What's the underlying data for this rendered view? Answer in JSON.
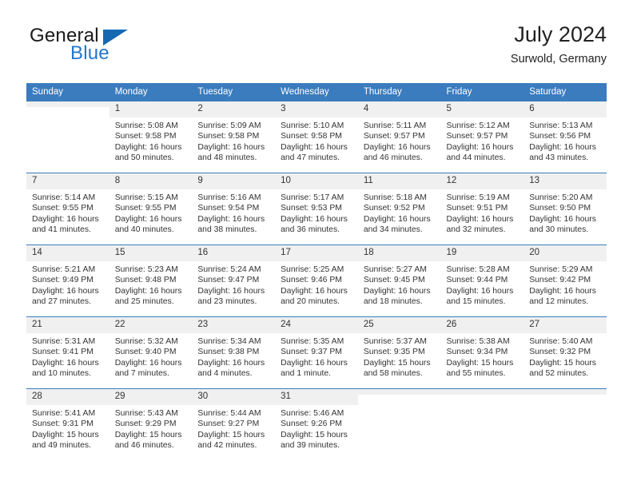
{
  "brand": {
    "name_part1": "General",
    "name_part2": "Blue",
    "triangle_color": "#1668b3",
    "blue_color": "#2277cc"
  },
  "header": {
    "title": "July 2024",
    "subtitle": "Surwold, Germany",
    "header_bg": "#3a7cbe",
    "daynum_bg": "#f0f0f0"
  },
  "weekdays": [
    "Sunday",
    "Monday",
    "Tuesday",
    "Wednesday",
    "Thursday",
    "Friday",
    "Saturday"
  ],
  "labels": {
    "sunrise": "Sunrise:",
    "sunset": "Sunset:",
    "daylight": "Daylight:"
  },
  "weeks": [
    [
      {
        "day": "",
        "sunrise": "",
        "sunset": "",
        "daylight1": "",
        "daylight2": ""
      },
      {
        "day": "1",
        "sunrise": "Sunrise: 5:08 AM",
        "sunset": "Sunset: 9:58 PM",
        "daylight1": "Daylight: 16 hours",
        "daylight2": "and 50 minutes."
      },
      {
        "day": "2",
        "sunrise": "Sunrise: 5:09 AM",
        "sunset": "Sunset: 9:58 PM",
        "daylight1": "Daylight: 16 hours",
        "daylight2": "and 48 minutes."
      },
      {
        "day": "3",
        "sunrise": "Sunrise: 5:10 AM",
        "sunset": "Sunset: 9:58 PM",
        "daylight1": "Daylight: 16 hours",
        "daylight2": "and 47 minutes."
      },
      {
        "day": "4",
        "sunrise": "Sunrise: 5:11 AM",
        "sunset": "Sunset: 9:57 PM",
        "daylight1": "Daylight: 16 hours",
        "daylight2": "and 46 minutes."
      },
      {
        "day": "5",
        "sunrise": "Sunrise: 5:12 AM",
        "sunset": "Sunset: 9:57 PM",
        "daylight1": "Daylight: 16 hours",
        "daylight2": "and 44 minutes."
      },
      {
        "day": "6",
        "sunrise": "Sunrise: 5:13 AM",
        "sunset": "Sunset: 9:56 PM",
        "daylight1": "Daylight: 16 hours",
        "daylight2": "and 43 minutes."
      }
    ],
    [
      {
        "day": "7",
        "sunrise": "Sunrise: 5:14 AM",
        "sunset": "Sunset: 9:55 PM",
        "daylight1": "Daylight: 16 hours",
        "daylight2": "and 41 minutes."
      },
      {
        "day": "8",
        "sunrise": "Sunrise: 5:15 AM",
        "sunset": "Sunset: 9:55 PM",
        "daylight1": "Daylight: 16 hours",
        "daylight2": "and 40 minutes."
      },
      {
        "day": "9",
        "sunrise": "Sunrise: 5:16 AM",
        "sunset": "Sunset: 9:54 PM",
        "daylight1": "Daylight: 16 hours",
        "daylight2": "and 38 minutes."
      },
      {
        "day": "10",
        "sunrise": "Sunrise: 5:17 AM",
        "sunset": "Sunset: 9:53 PM",
        "daylight1": "Daylight: 16 hours",
        "daylight2": "and 36 minutes."
      },
      {
        "day": "11",
        "sunrise": "Sunrise: 5:18 AM",
        "sunset": "Sunset: 9:52 PM",
        "daylight1": "Daylight: 16 hours",
        "daylight2": "and 34 minutes."
      },
      {
        "day": "12",
        "sunrise": "Sunrise: 5:19 AM",
        "sunset": "Sunset: 9:51 PM",
        "daylight1": "Daylight: 16 hours",
        "daylight2": "and 32 minutes."
      },
      {
        "day": "13",
        "sunrise": "Sunrise: 5:20 AM",
        "sunset": "Sunset: 9:50 PM",
        "daylight1": "Daylight: 16 hours",
        "daylight2": "and 30 minutes."
      }
    ],
    [
      {
        "day": "14",
        "sunrise": "Sunrise: 5:21 AM",
        "sunset": "Sunset: 9:49 PM",
        "daylight1": "Daylight: 16 hours",
        "daylight2": "and 27 minutes."
      },
      {
        "day": "15",
        "sunrise": "Sunrise: 5:23 AM",
        "sunset": "Sunset: 9:48 PM",
        "daylight1": "Daylight: 16 hours",
        "daylight2": "and 25 minutes."
      },
      {
        "day": "16",
        "sunrise": "Sunrise: 5:24 AM",
        "sunset": "Sunset: 9:47 PM",
        "daylight1": "Daylight: 16 hours",
        "daylight2": "and 23 minutes."
      },
      {
        "day": "17",
        "sunrise": "Sunrise: 5:25 AM",
        "sunset": "Sunset: 9:46 PM",
        "daylight1": "Daylight: 16 hours",
        "daylight2": "and 20 minutes."
      },
      {
        "day": "18",
        "sunrise": "Sunrise: 5:27 AM",
        "sunset": "Sunset: 9:45 PM",
        "daylight1": "Daylight: 16 hours",
        "daylight2": "and 18 minutes."
      },
      {
        "day": "19",
        "sunrise": "Sunrise: 5:28 AM",
        "sunset": "Sunset: 9:44 PM",
        "daylight1": "Daylight: 16 hours",
        "daylight2": "and 15 minutes."
      },
      {
        "day": "20",
        "sunrise": "Sunrise: 5:29 AM",
        "sunset": "Sunset: 9:42 PM",
        "daylight1": "Daylight: 16 hours",
        "daylight2": "and 12 minutes."
      }
    ],
    [
      {
        "day": "21",
        "sunrise": "Sunrise: 5:31 AM",
        "sunset": "Sunset: 9:41 PM",
        "daylight1": "Daylight: 16 hours",
        "daylight2": "and 10 minutes."
      },
      {
        "day": "22",
        "sunrise": "Sunrise: 5:32 AM",
        "sunset": "Sunset: 9:40 PM",
        "daylight1": "Daylight: 16 hours",
        "daylight2": "and 7 minutes."
      },
      {
        "day": "23",
        "sunrise": "Sunrise: 5:34 AM",
        "sunset": "Sunset: 9:38 PM",
        "daylight1": "Daylight: 16 hours",
        "daylight2": "and 4 minutes."
      },
      {
        "day": "24",
        "sunrise": "Sunrise: 5:35 AM",
        "sunset": "Sunset: 9:37 PM",
        "daylight1": "Daylight: 16 hours",
        "daylight2": "and 1 minute."
      },
      {
        "day": "25",
        "sunrise": "Sunrise: 5:37 AM",
        "sunset": "Sunset: 9:35 PM",
        "daylight1": "Daylight: 15 hours",
        "daylight2": "and 58 minutes."
      },
      {
        "day": "26",
        "sunrise": "Sunrise: 5:38 AM",
        "sunset": "Sunset: 9:34 PM",
        "daylight1": "Daylight: 15 hours",
        "daylight2": "and 55 minutes."
      },
      {
        "day": "27",
        "sunrise": "Sunrise: 5:40 AM",
        "sunset": "Sunset: 9:32 PM",
        "daylight1": "Daylight: 15 hours",
        "daylight2": "and 52 minutes."
      }
    ],
    [
      {
        "day": "28",
        "sunrise": "Sunrise: 5:41 AM",
        "sunset": "Sunset: 9:31 PM",
        "daylight1": "Daylight: 15 hours",
        "daylight2": "and 49 minutes."
      },
      {
        "day": "29",
        "sunrise": "Sunrise: 5:43 AM",
        "sunset": "Sunset: 9:29 PM",
        "daylight1": "Daylight: 15 hours",
        "daylight2": "and 46 minutes."
      },
      {
        "day": "30",
        "sunrise": "Sunrise: 5:44 AM",
        "sunset": "Sunset: 9:27 PM",
        "daylight1": "Daylight: 15 hours",
        "daylight2": "and 42 minutes."
      },
      {
        "day": "31",
        "sunrise": "Sunrise: 5:46 AM",
        "sunset": "Sunset: 9:26 PM",
        "daylight1": "Daylight: 15 hours",
        "daylight2": "and 39 minutes."
      },
      {
        "day": "",
        "sunrise": "",
        "sunset": "",
        "daylight1": "",
        "daylight2": ""
      },
      {
        "day": "",
        "sunrise": "",
        "sunset": "",
        "daylight1": "",
        "daylight2": ""
      },
      {
        "day": "",
        "sunrise": "",
        "sunset": "",
        "daylight1": "",
        "daylight2": ""
      }
    ]
  ]
}
